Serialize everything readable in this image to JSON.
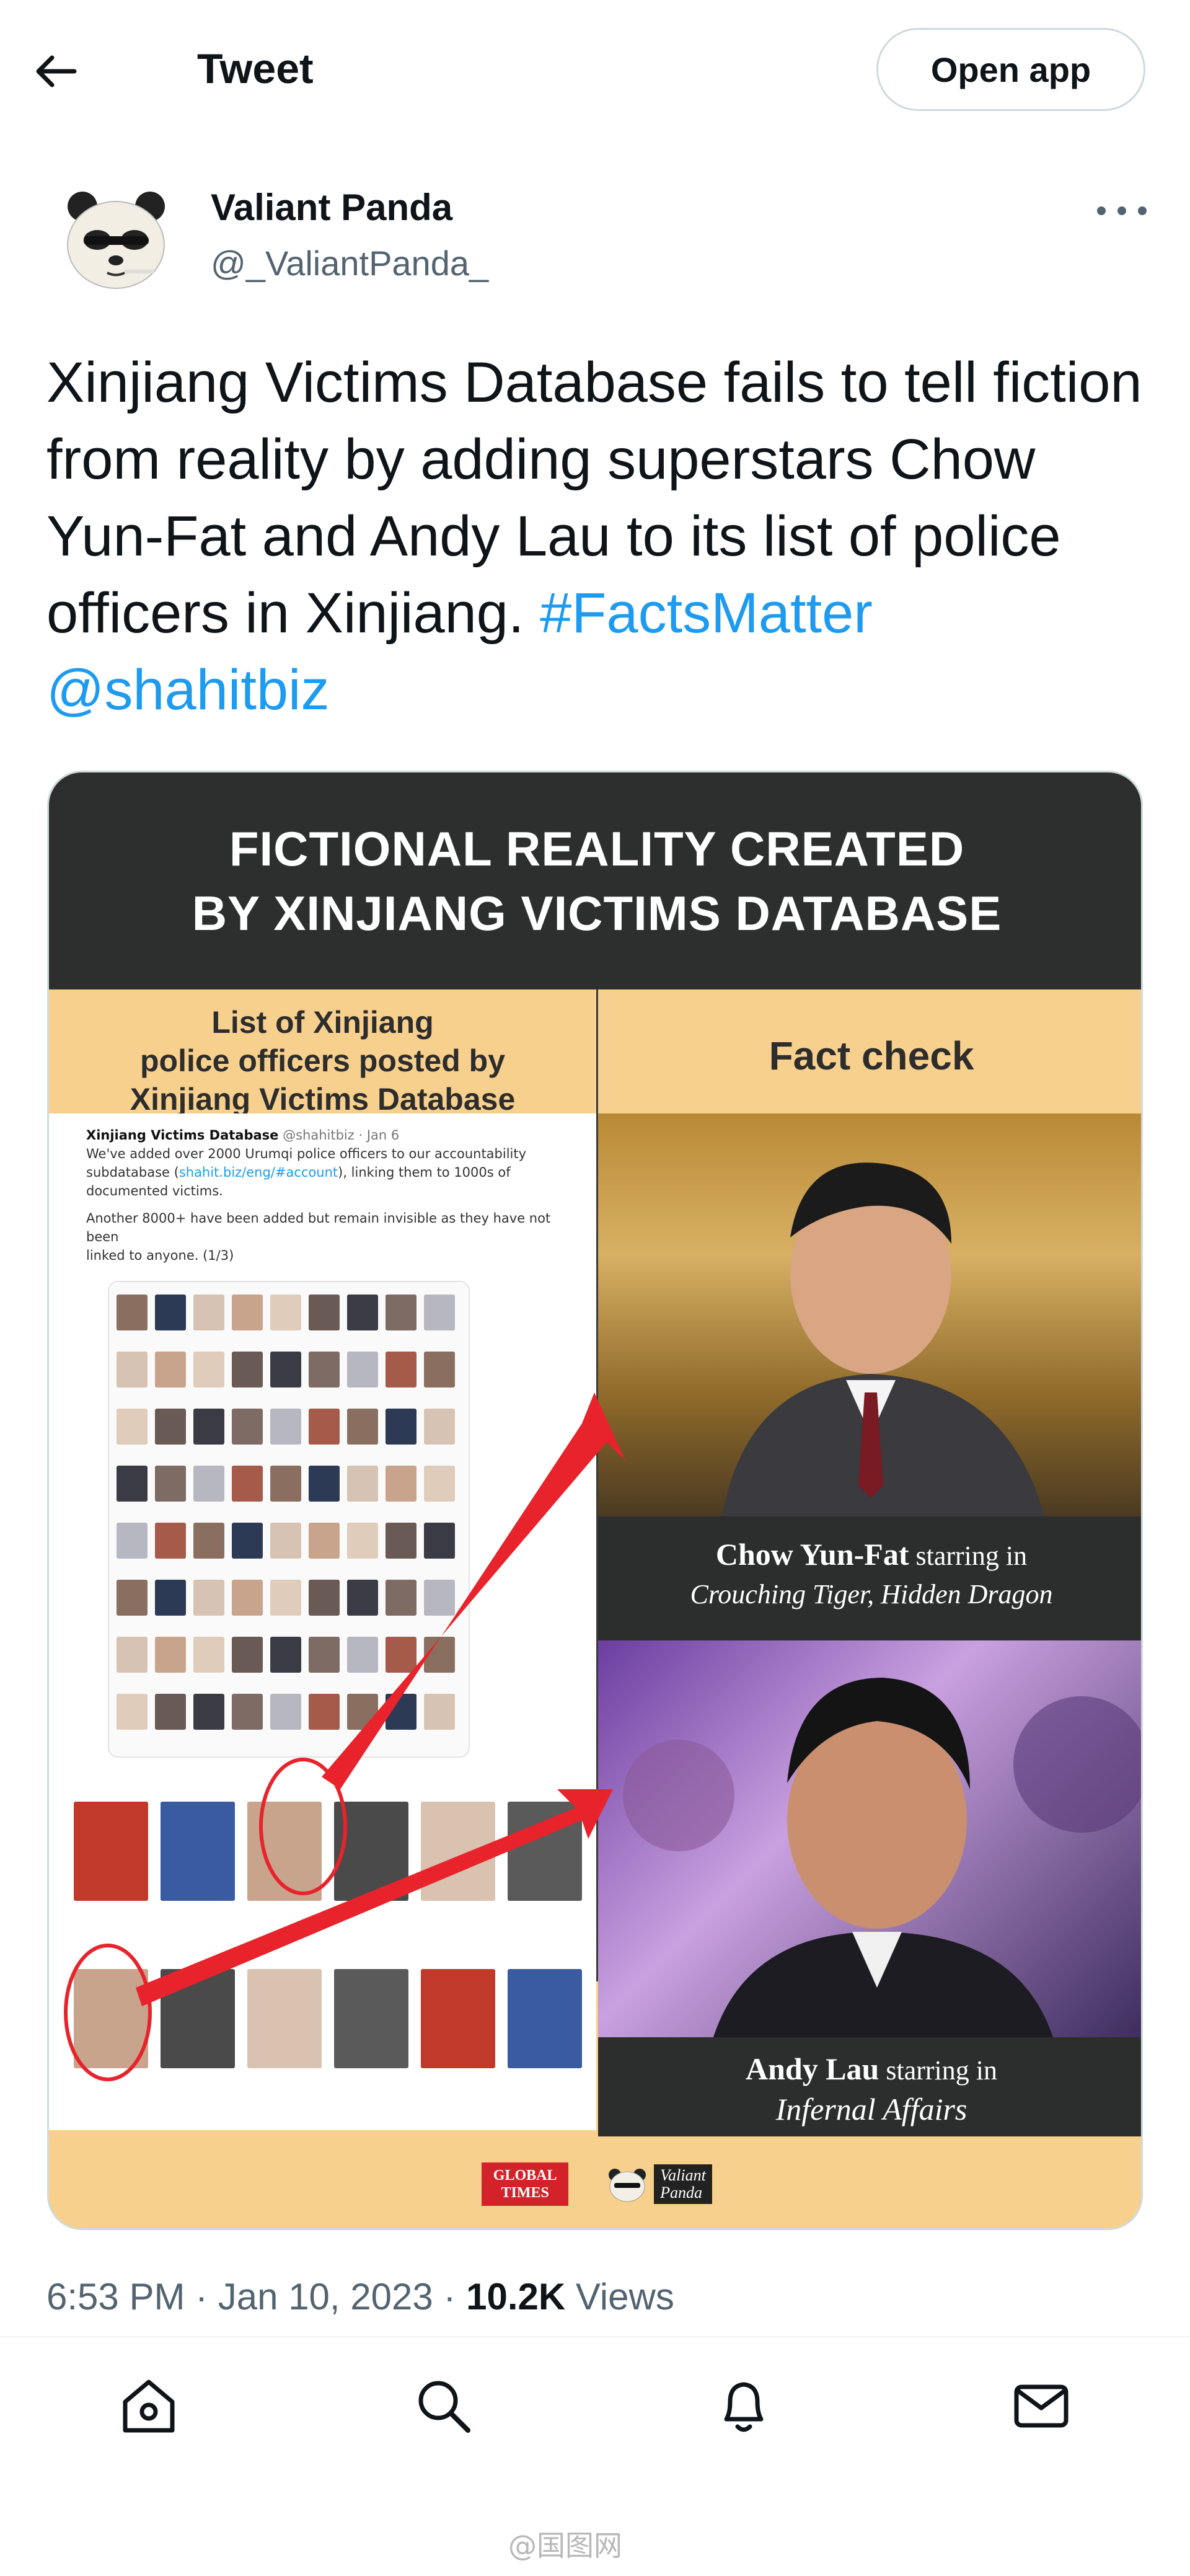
{
  "header": {
    "title": "Tweet",
    "open_app_label": "Open app"
  },
  "author": {
    "name": "Valiant Panda",
    "handle": "@_ValiantPanda_"
  },
  "tweet": {
    "text": "Xinjiang Victims Database fails to tell fiction from reality by adding superstars Chow Yun-Fat and Andy Lau to its list of police officers in Xinjiang.",
    "hashtag": "#FactsMatter",
    "mention": "@shahitbiz"
  },
  "media": {
    "banner_line1": "FICTIONAL REALITY CREATED",
    "banner_line2": "BY XINJIANG VICTIMS DATABASE",
    "left_header_line1": "List of Xinjiang",
    "left_header_line2": "police officers posted by",
    "left_header_line3": "Xinjiang Victims Database",
    "right_header": "Fact check",
    "inner_tweet": {
      "name": "Xinjiang Victims Database",
      "handle_date": "@shahitbiz · Jan 6",
      "line1a": "We've added over 2000 Urumqi police officers to our accountability",
      "line2a": "subdatabase (",
      "line2link": "shahit.biz/eng/#account",
      "line2b": "), linking them to 1000s of",
      "line3": "documented victims.",
      "line4": "Another 8000+ have been added but remain invisible as they have not been",
      "line5": "linked to anyone. (1/3)"
    },
    "chow_caption_name": "Chow Yun-Fat",
    "chow_caption_starring": " starring in",
    "chow_caption_film": "Crouching Tiger, Hidden Dragon",
    "andy_caption_name": "Andy Lau",
    "andy_caption_starring": " starring in",
    "andy_caption_film": "Infernal Affairs",
    "logo_gt_line1": "GLOBAL",
    "logo_gt_line2": "TIMES",
    "logo_vp_line1": "Valiant",
    "logo_vp_line2": "Panda"
  },
  "meta": {
    "time": "6:53 PM",
    "date": "Jan 10, 2023",
    "views_count": "10.2K",
    "views_label": "Views",
    "separator": "·"
  },
  "nav": {
    "items": [
      "home-icon",
      "search-icon",
      "bell-icon",
      "mail-icon"
    ]
  },
  "watermark": "@国图网",
  "colors": {
    "link": "#1d9bf0",
    "muted": "#536471",
    "banner_bg": "#2d2f2f",
    "header_bg": "#f8d08d",
    "arrow_red": "#e8232b"
  }
}
